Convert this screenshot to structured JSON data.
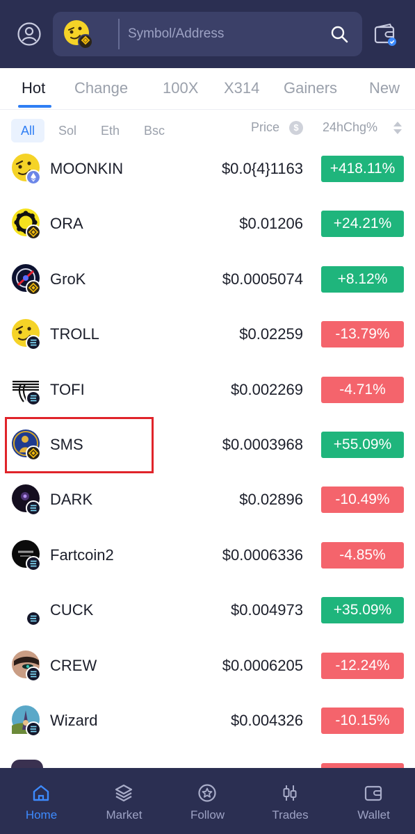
{
  "search": {
    "placeholder": "Symbol/Address"
  },
  "tabs": [
    "Hot",
    "Change",
    "100X",
    "X314",
    "Gainers",
    "New"
  ],
  "filters": [
    "All",
    "Sol",
    "Eth",
    "Bsc"
  ],
  "columns": {
    "price": "Price",
    "change": "24hChg%"
  },
  "colors": {
    "header_bg": "#2b2f52",
    "accent": "#2f7ef4",
    "up": "#1fb57c",
    "down": "#f4646c",
    "highlight": "#e0242a"
  },
  "coins": [
    {
      "name": "MOONKIN",
      "price": "$0.0{4}1163",
      "change": "+418.11%",
      "direction": "up",
      "chain": "eth",
      "icon": "smiley-coin-icon"
    },
    {
      "name": "ORA",
      "price": "$0.01206",
      "change": "+24.21%",
      "direction": "up",
      "chain": "bsc",
      "icon": "gear-coin-icon"
    },
    {
      "name": "GroK",
      "price": "$0.0005074",
      "change": "+8.12%",
      "direction": "up",
      "chain": "bsc",
      "icon": "grok-coin-icon"
    },
    {
      "name": "TROLL",
      "price": "$0.02259",
      "change": "-13.79%",
      "direction": "down",
      "chain": "sol",
      "icon": "smiley-coin-icon"
    },
    {
      "name": "TOFI",
      "price": "$0.002269",
      "change": "-4.71%",
      "direction": "down",
      "chain": "sol",
      "icon": "stripes-coin-icon"
    },
    {
      "name": "SMS",
      "price": "$0.0003968",
      "change": "+55.09%",
      "direction": "up",
      "chain": "bsc",
      "icon": "sms-coin-icon"
    },
    {
      "name": "DARK",
      "price": "$0.02896",
      "change": "-10.49%",
      "direction": "down",
      "chain": "sol",
      "icon": "dark-coin-icon"
    },
    {
      "name": "Fartcoin2",
      "price": "$0.0006336",
      "change": "-4.85%",
      "direction": "down",
      "chain": "sol",
      "icon": "fartcoin-icon"
    },
    {
      "name": "CUCK",
      "price": "$0.004973",
      "change": "+35.09%",
      "direction": "up",
      "chain": "sol",
      "icon": "blank-coin-icon"
    },
    {
      "name": "CREW",
      "price": "$0.0006205",
      "change": "-12.24%",
      "direction": "down",
      "chain": "sol",
      "icon": "crew-coin-icon"
    },
    {
      "name": "Wizard",
      "price": "$0.004326",
      "change": "-10.15%",
      "direction": "down",
      "chain": "sol",
      "icon": "wizard-coin-icon"
    }
  ],
  "nav": [
    {
      "label": "Home",
      "icon": "home-icon",
      "active": true
    },
    {
      "label": "Market",
      "icon": "layers-icon",
      "active": false
    },
    {
      "label": "Follow",
      "icon": "star-icon",
      "active": false
    },
    {
      "label": "Trades",
      "icon": "candlestick-icon",
      "active": false
    },
    {
      "label": "Wallet",
      "icon": "wallet-icon",
      "active": false
    }
  ]
}
